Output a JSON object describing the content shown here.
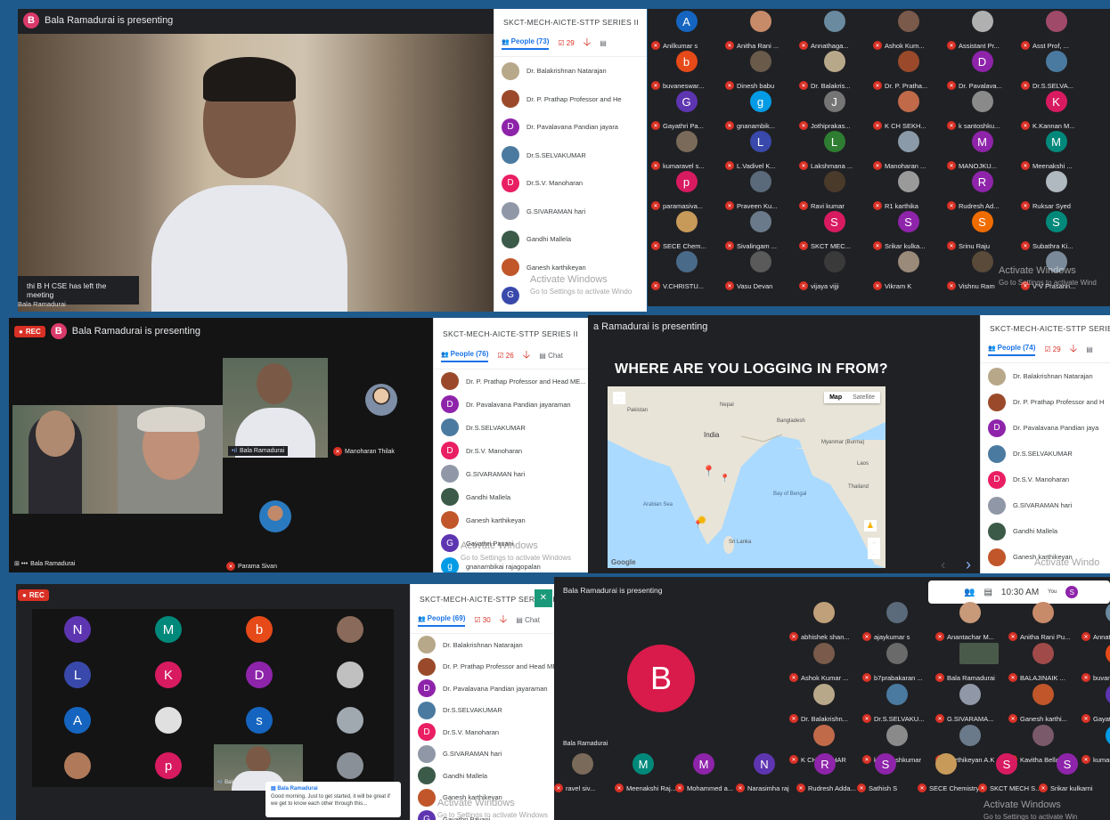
{
  "colors": {
    "bg": "#1f5a8c",
    "meet_dark": "#202124",
    "mute": "#d93025",
    "accent": "#1a73e8"
  },
  "p1": {
    "presenter": "Bala Ramadurai is presenting",
    "presenter_initial": "B",
    "toast": "thi B H CSE has left the meeting",
    "self_label": "Bala Ramadurai",
    "panel": {
      "title": "SKCT-MECH-AICTE-STTP SERIES II",
      "people": "People (73)",
      "check": "29",
      "items": [
        {
          "name": "Dr. Balakrishnan Natarajan",
          "initial": "",
          "color": "#b8a88a"
        },
        {
          "name": "Dr. P. Prathap Professor and He",
          "initial": "",
          "color": "#9a4a2a"
        },
        {
          "name": "Dr. Pavalavana Pandian jayara",
          "initial": "D",
          "color": "#8e24aa"
        },
        {
          "name": "Dr.S.SELVAKUMAR",
          "initial": "",
          "color": "#4a7aa0"
        },
        {
          "name": "Dr.S.V. Manoharan",
          "initial": "D",
          "color": "#e91e63"
        },
        {
          "name": "G.SIVARAMAN hari",
          "initial": "",
          "color": "#9098a8"
        },
        {
          "name": "Gandhi Mallela",
          "initial": "",
          "color": "#3c5a48"
        },
        {
          "name": "Ganesh karthikeyan",
          "initial": "",
          "color": "#c0562a"
        },
        {
          "name": "",
          "initial": "G",
          "color": "#3949ab"
        }
      ],
      "watermark": "Activate Windows",
      "watermark_sub": "Go to Settings to activate Windo"
    }
  },
  "p2": {
    "rows": [
      [
        {
          "n": "Anilkumar s",
          "i": "A",
          "c": "#1565c0"
        },
        {
          "n": "Anitha Rani ...",
          "i": "",
          "c": "#c88b6a"
        },
        {
          "n": "Annathaga...",
          "i": "",
          "c": "#6a8aa0"
        },
        {
          "n": "Ashok Kum...",
          "i": "",
          "c": "#7a5a4a"
        },
        {
          "n": "Assistant Pr...",
          "i": "",
          "c": "#b0b0b0"
        },
        {
          "n": "Asst Prof, ...",
          "i": "",
          "c": "#a04a6a"
        }
      ],
      [
        {
          "n": "buvaneswar...",
          "i": "b",
          "c": "#e64a19"
        },
        {
          "n": "Dinesh babu",
          "i": "",
          "c": "#6a5a4a"
        },
        {
          "n": "Dr. Balakris...",
          "i": "",
          "c": "#b8a88a"
        },
        {
          "n": "Dr. P. Pratha...",
          "i": "",
          "c": "#9a4a2a"
        },
        {
          "n": "Dr. Pavalava...",
          "i": "D",
          "c": "#8e24aa"
        },
        {
          "n": "Dr.S.SELVA...",
          "i": "",
          "c": "#4a7aa0"
        }
      ],
      [
        {
          "n": "Gayathri Pa...",
          "i": "G",
          "c": "#5e35b1"
        },
        {
          "n": "gnanambik...",
          "i": "g",
          "c": "#039be5"
        },
        {
          "n": "Jothiprakas...",
          "i": "J",
          "c": "#757575"
        },
        {
          "n": "K CH SEKH...",
          "i": "",
          "c": "#c06a4a"
        },
        {
          "n": "k santoshku...",
          "i": "",
          "c": "#8a8a8a"
        },
        {
          "n": "K.Kannan M...",
          "i": "K",
          "c": "#d81b60"
        }
      ],
      [
        {
          "n": "kumaravel s...",
          "i": "",
          "c": "#7a6a5a"
        },
        {
          "n": "L.Vadivel K...",
          "i": "L",
          "c": "#3949ab"
        },
        {
          "n": "Lakshmana ...",
          "i": "L",
          "c": "#2e7d32"
        },
        {
          "n": "Manoharan ...",
          "i": "",
          "c": "#8a9aa8"
        },
        {
          "n": "MANOJKU...",
          "i": "M",
          "c": "#8e24aa"
        },
        {
          "n": "Meenakshi ...",
          "i": "M",
          "c": "#00897b"
        }
      ],
      [
        {
          "n": "paramasiva...",
          "i": "p",
          "c": "#d81b60"
        },
        {
          "n": "Praveen Ku...",
          "i": "",
          "c": "#5a6a7a"
        },
        {
          "n": "Ravi kumar",
          "i": "",
          "c": "#4a3a2a"
        },
        {
          "n": "R1 karthika",
          "i": "",
          "c": "#9a9a9a"
        },
        {
          "n": "Rudresh Ad...",
          "i": "R",
          "c": "#8e24aa"
        },
        {
          "n": "Ruksar Syed",
          "i": "",
          "c": "#b0b8c0"
        }
      ],
      [
        {
          "n": "SECE Chem...",
          "i": "",
          "c": "#c89a5a"
        },
        {
          "n": "Sivalingam ...",
          "i": "",
          "c": "#6a7a8a"
        },
        {
          "n": "SKCT MEC...",
          "i": "S",
          "c": "#d81b60"
        },
        {
          "n": "Srikar kulka...",
          "i": "S",
          "c": "#8e24aa"
        },
        {
          "n": "Srinu Raju",
          "i": "S",
          "c": "#ef6c00"
        },
        {
          "n": "Subathra Ki...",
          "i": "S",
          "c": "#00897b"
        }
      ],
      [
        {
          "n": "V.CHRISTU...",
          "i": "",
          "c": "#4a6a8a"
        },
        {
          "n": "Vasu Devan",
          "i": "",
          "c": "#5a5a5a"
        },
        {
          "n": "vijaya vijji",
          "i": "",
          "c": "#3a3a3a"
        },
        {
          "n": "Vikram K",
          "i": "",
          "c": "#9a8a7a"
        },
        {
          "n": "Vishnu Ram",
          "i": "",
          "c": "#5a4a3a"
        },
        {
          "n": "V V Prasann...",
          "i": "",
          "c": "#7a8a9a"
        }
      ]
    ],
    "watermark": "Activate Windows",
    "watermark_sub": "Go to Settings to activate Wind"
  },
  "p3": {
    "rec": "REC",
    "presenter": "Bala Ramadurai is presenting",
    "presenter_initial": "B",
    "tile_speaker": "Bala Ramadurai",
    "tile_muted": "Manoharan Thilak",
    "tile_bottom": "Parama Sivan",
    "self": "Bala Ramadurai",
    "panel": {
      "title": "SKCT-MECH-AICTE-STTP SERIES II",
      "people": "People (76)",
      "check": "26",
      "chat": "Chat",
      "items": [
        {
          "name": "Dr. P. Prathap Professor and Head ME...",
          "initial": "",
          "color": "#9a4a2a"
        },
        {
          "name": "Dr. Pavalavana Pandian jayaraman",
          "initial": "D",
          "color": "#8e24aa"
        },
        {
          "name": "Dr.S.SELVAKUMAR",
          "initial": "",
          "color": "#4a7aa0"
        },
        {
          "name": "Dr.S.V. Manoharan",
          "initial": "D",
          "color": "#e91e63"
        },
        {
          "name": "G.SIVARAMAN hari",
          "initial": "",
          "color": "#9098a8"
        },
        {
          "name": "Gandhi Mallela",
          "initial": "",
          "color": "#3c5a48"
        },
        {
          "name": "Ganesh karthikeyan",
          "initial": "",
          "color": "#c0562a"
        },
        {
          "name": "Gayathri Pavani",
          "initial": "G",
          "color": "#5e35b1"
        },
        {
          "name": "gnanambikai rajagopalan",
          "initial": "g",
          "color": "#039be5"
        }
      ],
      "watermark": "Activate Windows",
      "watermark_sub": "Go to Settings to activate Windows"
    }
  },
  "p4": {
    "presenter": "a Ramadurai is presenting",
    "map_title": "WHERE ARE YOU LOGGING IN FROM?",
    "map_btns": [
      "Map",
      "Satellite"
    ],
    "map_labels": [
      "India",
      "Nepal",
      "Bangladesh",
      "Pakistan",
      "Myanmar (Burma)",
      "Thailand",
      "Sri Lanka",
      "Bay of Bengal",
      "Arabian Sea",
      "Laos"
    ],
    "google": "Google",
    "panel": {
      "title": "SKCT-MECH-AICTE-STTP SERIES",
      "people": "People (74)",
      "check": "29",
      "items": [
        {
          "name": "Dr. Balakrishnan Natarajan",
          "initial": "",
          "color": "#b8a88a"
        },
        {
          "name": "Dr. P. Prathap Professor and H",
          "initial": "",
          "color": "#9a4a2a"
        },
        {
          "name": "Dr. Pavalavana Pandian jaya",
          "initial": "D",
          "color": "#8e24aa"
        },
        {
          "name": "Dr.S.SELVAKUMAR",
          "initial": "",
          "color": "#4a7aa0"
        },
        {
          "name": "Dr.S.V. Manoharan",
          "initial": "D",
          "color": "#e91e63"
        },
        {
          "name": "G.SIVARAMAN hari",
          "initial": "",
          "color": "#9098a8"
        },
        {
          "name": "Gandhi Mallela",
          "initial": "",
          "color": "#3c5a48"
        },
        {
          "name": "Ganesh karthikeyan",
          "initial": "",
          "color": "#c0562a"
        }
      ],
      "watermark": "Activate Windo",
      "watermark_sub": ""
    }
  },
  "p5": {
    "rec": "REC",
    "grid": [
      {
        "i": "N",
        "c": "#5e35b1"
      },
      {
        "i": "M",
        "c": "#00897b"
      },
      {
        "i": "b",
        "c": "#e64a19"
      },
      {
        "i": "",
        "c": "#8a6a5a"
      },
      {
        "i": "L",
        "c": "#3949ab"
      },
      {
        "i": "K",
        "c": "#d81b60"
      },
      {
        "i": "D",
        "c": "#8e24aa"
      },
      {
        "i": "",
        "c": "#c0c0c0"
      },
      {
        "i": "A",
        "c": "#1565c0"
      },
      {
        "i": "",
        "c": "#e0e0e0"
      },
      {
        "i": "s",
        "c": "#1565c0"
      },
      {
        "i": "",
        "c": "#a0a8b0"
      },
      {
        "i": "",
        "c": "#b07a5a"
      },
      {
        "i": "p",
        "c": "#d81b60"
      },
      {
        "i": "",
        "c": ""
      },
      {
        "i": "",
        "c": "#8a9098"
      }
    ],
    "tile_self": "Bala Ramadurai",
    "chat": {
      "sender": "Bala Ramadurai",
      "msg": "Good morning. Just to get started, it will be great if we get to know each other through this..."
    },
    "panel": {
      "title": "SKCT-MECH-AICTE-STTP SERIES II",
      "people": "People (69)",
      "check": "30",
      "chat": "Chat",
      "items": [
        {
          "name": "Dr. Balakrishnan Natarajan",
          "initial": "",
          "color": "#b8a88a"
        },
        {
          "name": "Dr. P. Prathap Professor and Head ME...",
          "initial": "",
          "color": "#9a4a2a"
        },
        {
          "name": "Dr. Pavalavana Pandian jayaraman",
          "initial": "D",
          "color": "#8e24aa"
        },
        {
          "name": "Dr.S.SELVAKUMAR",
          "initial": "",
          "color": "#4a7aa0"
        },
        {
          "name": "Dr.S.V. Manoharan",
          "initial": "D",
          "color": "#e91e63"
        },
        {
          "name": "G.SIVARAMAN hari",
          "initial": "",
          "color": "#9098a8"
        },
        {
          "name": "Gandhi Mallela",
          "initial": "",
          "color": "#3c5a48"
        },
        {
          "name": "Ganesh karthikeyan",
          "initial": "",
          "color": "#c0562a"
        },
        {
          "name": "Gayathri Pavani",
          "initial": "G",
          "color": "#5e35b1"
        }
      ],
      "watermark": "Activate Windows",
      "watermark_sub": "Go to Settings to activate Windows"
    }
  },
  "p6": {
    "presenter": "Bala Ramadurai is presenting",
    "time": "10:30 AM",
    "you": "You",
    "big_initial": "B",
    "left_label": "Bala Ramadurai",
    "rows": [
      [
        {
          "n": "abhishek shan...",
          "i": "",
          "c": "#c0a07a"
        },
        {
          "n": "ajaykumar s",
          "i": "",
          "c": "#5a6a7a"
        },
        {
          "n": "Anantachar M...",
          "i": "",
          "c": "#c89a7a"
        },
        {
          "n": "Anitha Rani Pu...",
          "i": "",
          "c": "#c88b6a"
        },
        {
          "n": "Annathagan R...",
          "i": "",
          "c": "#6a8aa0"
        }
      ],
      [
        {
          "n": "Ashok Kumar ...",
          "i": "",
          "c": "#7a5a4a"
        },
        {
          "n": "b7prabakaran ...",
          "i": "",
          "c": "#6a6a6a"
        },
        {
          "n": "Bala Ramadurai",
          "i": "",
          "c": ""
        },
        {
          "n": "BALAJINAIK ...",
          "i": "",
          "c": "#a04a4a"
        },
        {
          "n": "buvaneswari v...",
          "i": "b",
          "c": "#e64a19"
        }
      ],
      [
        {
          "n": "Dr. Balakrishn...",
          "i": "",
          "c": "#b8a88a"
        },
        {
          "n": "Dr.S.SELVAKU...",
          "i": "",
          "c": "#4a7aa0"
        },
        {
          "n": "G.SIVARAMA...",
          "i": "",
          "c": "#9098a8"
        },
        {
          "n": "Ganesh karthi...",
          "i": "",
          "c": "#c0562a"
        },
        {
          "n": "Gayathri Pavani",
          "i": "G",
          "c": "#5e35b1"
        }
      ],
      [
        {
          "n": "K CH SEKHAR",
          "i": "",
          "c": "#c06a4a"
        },
        {
          "n": "k santoshkumar",
          "i": "",
          "c": "#8a8a8a"
        },
        {
          "n": "Karthikeyan A.K",
          "i": "",
          "c": "#6a7a8a"
        },
        {
          "n": "Kavitha Bellan",
          "i": "",
          "c": "#7a5a6a"
        },
        {
          "n": "kumar sudu",
          "i": "k",
          "c": "#039be5"
        }
      ]
    ],
    "bottom": [
      {
        "n": "ravel siv...",
        "i": "",
        "c": "#7a6a5a"
      },
      {
        "n": "Meenakshi Raj...",
        "i": "M",
        "c": "#00897b"
      },
      {
        "n": "Mohammed a...",
        "i": "M",
        "c": "#8e24aa"
      },
      {
        "n": "Narasimha raj",
        "i": "N",
        "c": "#5e35b1"
      },
      {
        "n": "Rudresh Adda...",
        "i": "R",
        "c": "#8e24aa"
      },
      {
        "n": "Sathish S",
        "i": "S",
        "c": "#8e24aa"
      },
      {
        "n": "SECE Chemistry",
        "i": "",
        "c": "#c89a5a"
      },
      {
        "n": "SKCT MECH S...",
        "i": "S",
        "c": "#d81b60"
      },
      {
        "n": "Srikar kulkarni",
        "i": "S",
        "c": "#8e24aa"
      }
    ],
    "watermark": "Activate Windows",
    "watermark_sub": "Go to Settings to activate Win"
  }
}
